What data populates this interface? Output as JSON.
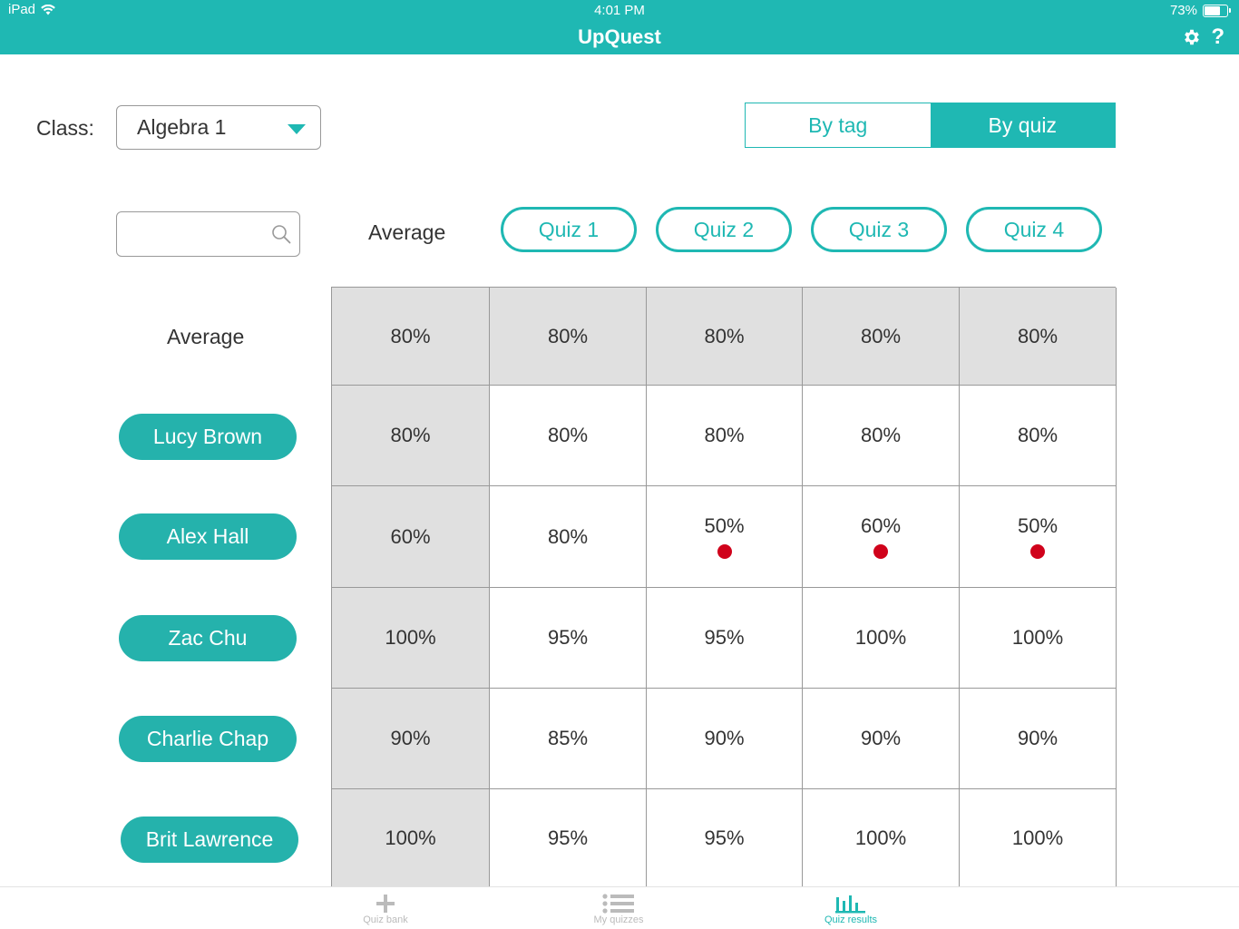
{
  "status": {
    "device": "iPad",
    "time": "4:01 PM",
    "battery": "73%",
    "battery_level": 0.73
  },
  "app": {
    "title": "UpQuest"
  },
  "filters": {
    "class_label": "Class:",
    "class_value": "Algebra 1",
    "view_by_tag": "By tag",
    "view_by_quiz": "By quiz",
    "selected_view": "By quiz",
    "search_value": ""
  },
  "table": {
    "average_header": "Average",
    "average_row_label": "Average",
    "quizzes": [
      "Quiz 1",
      "Quiz 2",
      "Quiz 3",
      "Quiz 4"
    ],
    "average_row": [
      "80%",
      "80%",
      "80%",
      "80%",
      "80%"
    ],
    "students": [
      {
        "name": "Lucy Brown",
        "scores": [
          "80%",
          "80%",
          "80%",
          "80%",
          "80%"
        ],
        "flags": [
          false,
          false,
          false,
          false,
          false
        ]
      },
      {
        "name": "Alex Hall",
        "scores": [
          "60%",
          "80%",
          "50%",
          "60%",
          "50%"
        ],
        "flags": [
          false,
          false,
          true,
          true,
          true
        ]
      },
      {
        "name": "Zac Chu",
        "scores": [
          "100%",
          "95%",
          "95%",
          "100%",
          "100%"
        ],
        "flags": [
          false,
          false,
          false,
          false,
          false
        ]
      },
      {
        "name": "Charlie Chap",
        "scores": [
          "90%",
          "85%",
          "90%",
          "90%",
          "90%"
        ],
        "flags": [
          false,
          false,
          false,
          false,
          false
        ]
      },
      {
        "name": "Brit Lawrence",
        "scores": [
          "100%",
          "95%",
          "95%",
          "100%",
          "100%"
        ],
        "flags": [
          false,
          false,
          false,
          false,
          false
        ]
      }
    ],
    "flag_color": "#d0021b"
  },
  "tabs": [
    {
      "label": "Quiz bank",
      "icon": "plus-icon",
      "active": false
    },
    {
      "label": "My quizzes",
      "icon": "list-icon",
      "active": false
    },
    {
      "label": "Quiz results",
      "icon": "bar-chart-icon",
      "active": true
    }
  ],
  "colors": {
    "accent": "#1fb8b3",
    "student_button": "#25b2ac",
    "average_cell": "#e0e0e0"
  }
}
